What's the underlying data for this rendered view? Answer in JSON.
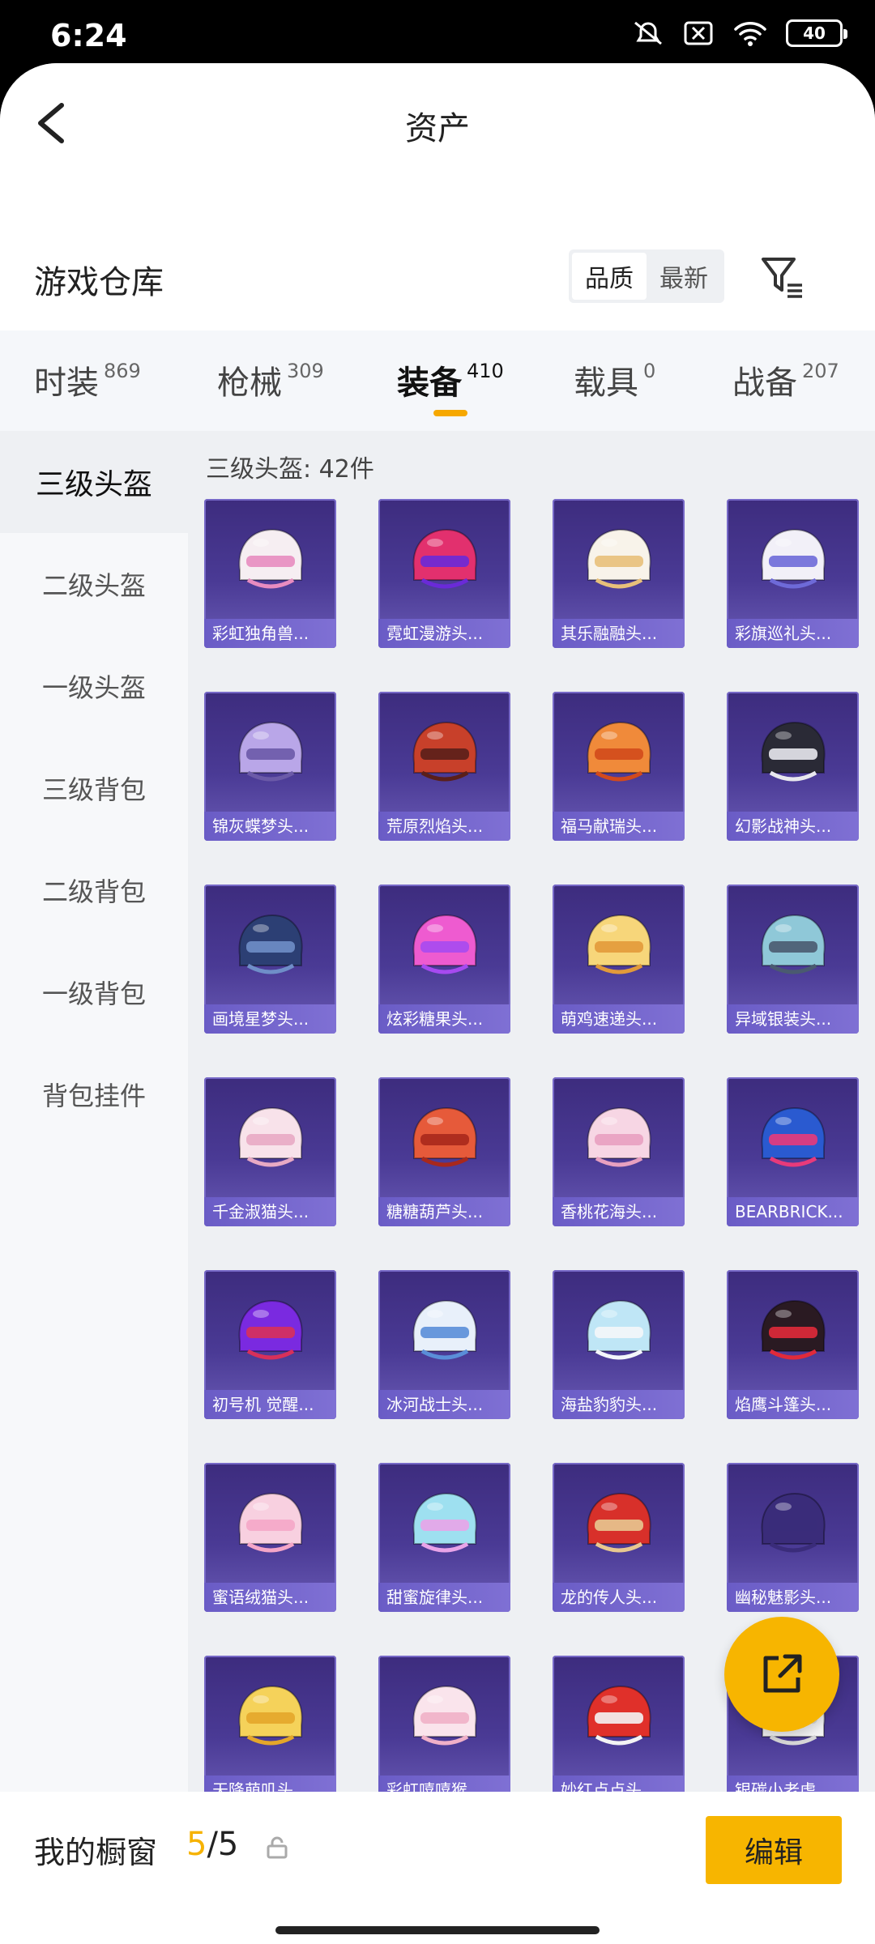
{
  "status": {
    "time": "6:24",
    "battery": "40"
  },
  "header": {
    "title": "资产"
  },
  "warehouse": {
    "title": "游戏仓库",
    "sort_options": [
      "品质",
      "最新"
    ]
  },
  "categories": [
    {
      "label": "时装",
      "count": "869"
    },
    {
      "label": "枪械",
      "count": "309"
    },
    {
      "label": "装备",
      "count": "410"
    },
    {
      "label": "载具",
      "count": "0"
    },
    {
      "label": "战备",
      "count": "207"
    }
  ],
  "sidebar": {
    "items": [
      "三级头盔",
      "二级头盔",
      "一级头盔",
      "三级背包",
      "二级背包",
      "一级背包",
      "背包挂件"
    ]
  },
  "list": {
    "title": "三级头盔: 42件",
    "items": [
      {
        "label": "彩虹独角兽...",
        "c1": "#f6eef2",
        "c2": "#e88cc0"
      },
      {
        "label": "霓虹漫游头...",
        "c1": "#e2306e",
        "c2": "#6a2ad8"
      },
      {
        "label": "其乐融融头...",
        "c1": "#f8f3ea",
        "c2": "#e8c07a"
      },
      {
        "label": "彩旗巡礼头...",
        "c1": "#f2f0f8",
        "c2": "#6e6ad8"
      },
      {
        "label": "锦灰蝶梦头...",
        "c1": "#b9a6e8",
        "c2": "#6b5aa8"
      },
      {
        "label": "荒原烈焰头...",
        "c1": "#c8402a",
        "c2": "#5a1f1a"
      },
      {
        "label": "福马献瑞头...",
        "c1": "#f08a3a",
        "c2": "#d24a1c"
      },
      {
        "label": "幻影战神头...",
        "c1": "#2a2a36",
        "c2": "#e8e8ee"
      },
      {
        "label": "画境星梦头...",
        "c1": "#2c3f74",
        "c2": "#6f8ec8"
      },
      {
        "label": "炫彩糖果头...",
        "c1": "#ee5bd0",
        "c2": "#a64af0"
      },
      {
        "label": "萌鸡速递头...",
        "c1": "#f7d67a",
        "c2": "#e29a3a"
      },
      {
        "label": "异域银装头...",
        "c1": "#8fc8d8",
        "c2": "#4a5a70"
      },
      {
        "label": "千金淑猫头...",
        "c1": "#f8e2ea",
        "c2": "#e8aac4"
      },
      {
        "label": "糖糖葫芦头...",
        "c1": "#e65a3a",
        "c2": "#a8281c"
      },
      {
        "label": "香桃花海头...",
        "c1": "#f7d6e4",
        "c2": "#e8a0c0"
      },
      {
        "label": "BEARBRICK...",
        "c1": "#2a5ad0",
        "c2": "#e83a7a"
      },
      {
        "label": "初号机 觉醒...",
        "c1": "#7a2ae0",
        "c2": "#d8305a"
      },
      {
        "label": "冰河战士头...",
        "c1": "#e8f0fa",
        "c2": "#5a8ed8"
      },
      {
        "label": "海盐豹豹头...",
        "c1": "#bfe6f6",
        "c2": "#f4f6fa"
      },
      {
        "label": "焰鹰斗篷头...",
        "c1": "#2a1a22",
        "c2": "#e02a3a"
      },
      {
        "label": "蜜语绒猫头...",
        "c1": "#f8d0e0",
        "c2": "#f4a6c8"
      },
      {
        "label": "甜蜜旋律头...",
        "c1": "#9ee0f0",
        "c2": "#e8a4e8"
      },
      {
        "label": "龙的传人头...",
        "c1": "#d8302a",
        "c2": "#e8c890"
      },
      {
        "label": "幽秘魅影头...",
        "c1": "#3a2c7a",
        "c2": "#3a2c7a"
      },
      {
        "label": "天降萌叽头...",
        "c1": "#f5d25a",
        "c2": "#e4a62a"
      },
      {
        "label": "彩虹嘻嘻猴...",
        "c1": "#fae4ec",
        "c2": "#f0b0c8"
      },
      {
        "label": "妙红点点头...",
        "c1": "#e0302a",
        "c2": "#f4f4f4"
      },
      {
        "label": "银碳小老虎...",
        "c1": "#f4f4f4",
        "c2": "#d8d8d8"
      }
    ]
  },
  "bottom": {
    "showcase_label": "我的橱窗",
    "showcase_current": "5",
    "showcase_total": "/5",
    "edit_label": "编辑"
  },
  "colors": {
    "accent": "#f7b500",
    "card_bg": "#3d2c7e"
  }
}
